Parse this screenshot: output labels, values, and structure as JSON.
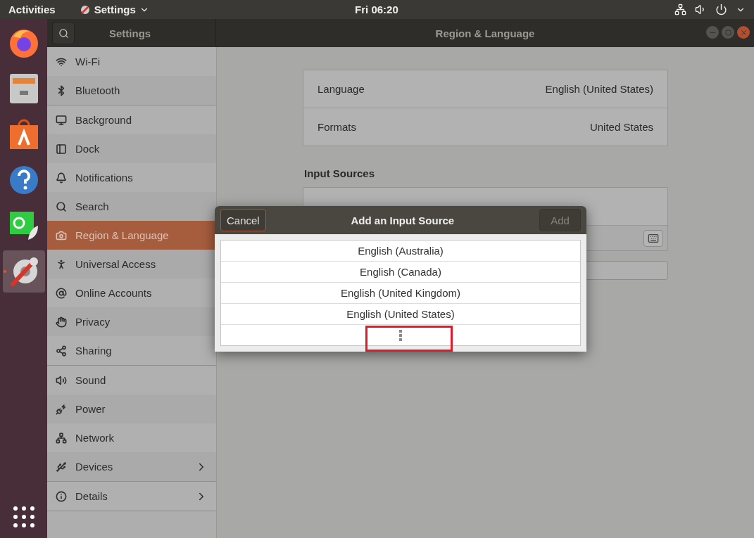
{
  "top_bar": {
    "activities": "Activities",
    "app_menu": "Settings",
    "clock": "Fri 06:20"
  },
  "dock": {
    "items": [
      {
        "selected": false
      },
      {
        "selected": false
      },
      {
        "selected": false
      },
      {
        "selected": false
      },
      {
        "selected": false
      },
      {
        "selected": true
      }
    ]
  },
  "window": {
    "sidebar_title": "Settings",
    "title": "Region & Language"
  },
  "sidebar": {
    "groups": [
      {
        "items": [
          {
            "label": "Wi-Fi",
            "selected": false,
            "has_submenu": false
          },
          {
            "label": "Bluetooth",
            "selected": false,
            "has_submenu": false
          }
        ]
      },
      {
        "items": [
          {
            "label": "Background",
            "selected": false,
            "has_submenu": false
          },
          {
            "label": "Dock",
            "selected": false,
            "has_submenu": false
          },
          {
            "label": "Notifications",
            "selected": false,
            "has_submenu": false
          },
          {
            "label": "Search",
            "selected": false,
            "has_submenu": false
          },
          {
            "label": "Region & Language",
            "selected": true,
            "has_submenu": false
          },
          {
            "label": "Universal Access",
            "selected": false,
            "has_submenu": false
          },
          {
            "label": "Online Accounts",
            "selected": false,
            "has_submenu": false
          },
          {
            "label": "Privacy",
            "selected": false,
            "has_submenu": false
          },
          {
            "label": "Sharing",
            "selected": false,
            "has_submenu": false
          }
        ]
      },
      {
        "items": [
          {
            "label": "Sound",
            "selected": false,
            "has_submenu": false
          },
          {
            "label": "Power",
            "selected": false,
            "has_submenu": false
          },
          {
            "label": "Network",
            "selected": false,
            "has_submenu": false
          },
          {
            "label": "Devices",
            "selected": false,
            "has_submenu": true
          }
        ]
      },
      {
        "items": [
          {
            "label": "Details",
            "selected": false,
            "has_submenu": true
          }
        ]
      }
    ]
  },
  "language_panel": {
    "rows": [
      {
        "label": "Language",
        "value": "English (United States)"
      },
      {
        "label": "Formats",
        "value": "United States"
      }
    ]
  },
  "input_sources": {
    "heading": "Input Sources"
  },
  "dialog": {
    "cancel": "Cancel",
    "title": "Add an Input Source",
    "add": {
      "label": "Add",
      "disabled": true
    },
    "options": [
      "English (Australia)",
      "English (Canada)",
      "English (United Kingdom)",
      "English (United States)"
    ]
  }
}
